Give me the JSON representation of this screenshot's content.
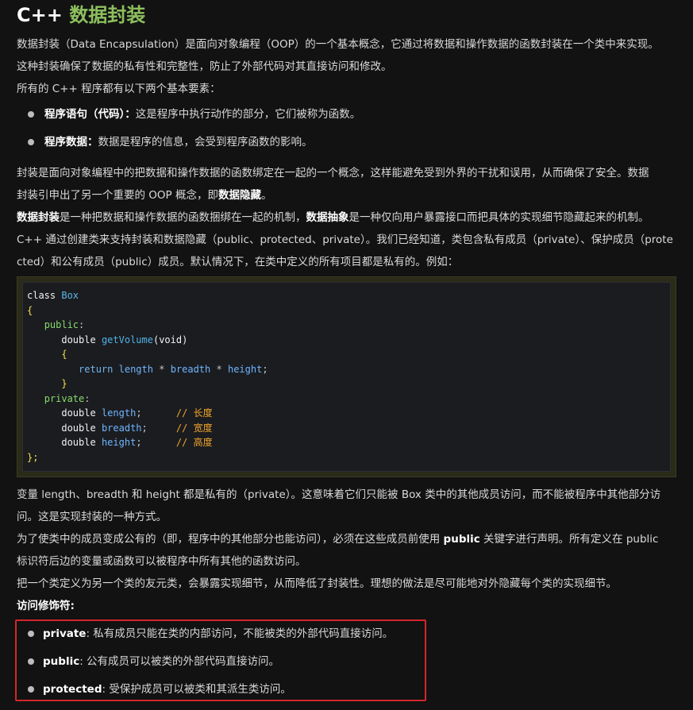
{
  "title": {
    "cpp": "C++",
    "rest": "数据封装"
  },
  "intro": [
    "数据封装（Data Encapsulation）是面向对象编程（OOP）的一个基本概念，它通过将数据和操作数据的函数封装在一个类中来实现。",
    "这种封装确保了数据的私有性和完整性，防止了外部代码对其直接访问和修改。",
    "所有的 C++ 程序都有以下两个基本要素："
  ],
  "elements": [
    {
      "term": "程序语句（代码）：",
      "desc": "这是程序中执行动作的部分，它们被称为函数。"
    },
    {
      "term": "程序数据：",
      "desc": "数据是程序的信息，会受到程序函数的影响。"
    }
  ],
  "para2": {
    "line1": "封装是面向对象编程中的把数据和操作数据的函数绑定在一起的一个概念，这样能避免受到外界的干扰和误用，从而确保了安全。数据",
    "line2_pre": "封装引申出了另一个重要的 OOP 概念，即",
    "line2_bold": "数据隐藏",
    "line2_post": "。"
  },
  "para3": {
    "b1": "数据封装",
    "t1": "是一种把数据和操作数据的函数捆绑在一起的机制，",
    "b2": "数据抽象",
    "t2": "是一种仅向用户暴露接口而把具体的实现细节隐藏起来的机制。"
  },
  "para4": [
    "C++ 通过创建类来支持封装和数据隐藏（public、protected、private）。我们已经知道，类包含私有成员（private）、保护成员（prote",
    "cted）和公有成员（public）成员。默认情况下，在类中定义的所有项目都是私有的。例如："
  ],
  "code": {
    "class_kw": "class",
    "class_name": "Box",
    "open_brace": "{",
    "public_kw": "public",
    "double_kw": "double",
    "fn_name": "getVolume",
    "fn_args": "(void)",
    "return_kw": "return",
    "length": "length",
    "breadth": "breadth",
    "height": "height",
    "star": "*",
    "private_kw": "private",
    "close_brace": "};",
    "comment_length": "// 长度",
    "comment_breadth": "// 宽度",
    "comment_height": "// 高度"
  },
  "para5": [
    "变量 length、breadth 和 height 都是私有的（private）。这意味着它们只能被 Box 类中的其他成员访问，而不能被程序中其他部分访",
    "问。这是实现封装的一种方式。"
  ],
  "para6": {
    "pre": "为了使类中的成员变成公有的（即，程序中的其他部分也能访问），必须在这些成员前使用 ",
    "bold": "public",
    "post": " 关键字进行声明。所有定义在 public",
    "line2": "标识符后边的变量或函数可以被程序中所有其他的函数访问。"
  },
  "para7": "把一个类定义为另一个类的友元类，会暴露实现细节，从而降低了封装性。理想的做法是尽可能地对外隐藏每个类的实现细节。",
  "access_heading": "访问修饰符:",
  "access_modifiers": [
    {
      "name": "private",
      "desc": ": 私有成员只能在类的内部访问，不能被类的外部代码直接访问。"
    },
    {
      "name": "public",
      "desc": ": 公有成员可以被类的外部代码直接访问。"
    },
    {
      "name": "protected",
      "desc": ": 受保护成员可以被类和其派生类访问。"
    }
  ],
  "colors": {
    "title_green": "#8dbf5e",
    "highlight_red": "#d3262b",
    "background": "#121212"
  }
}
